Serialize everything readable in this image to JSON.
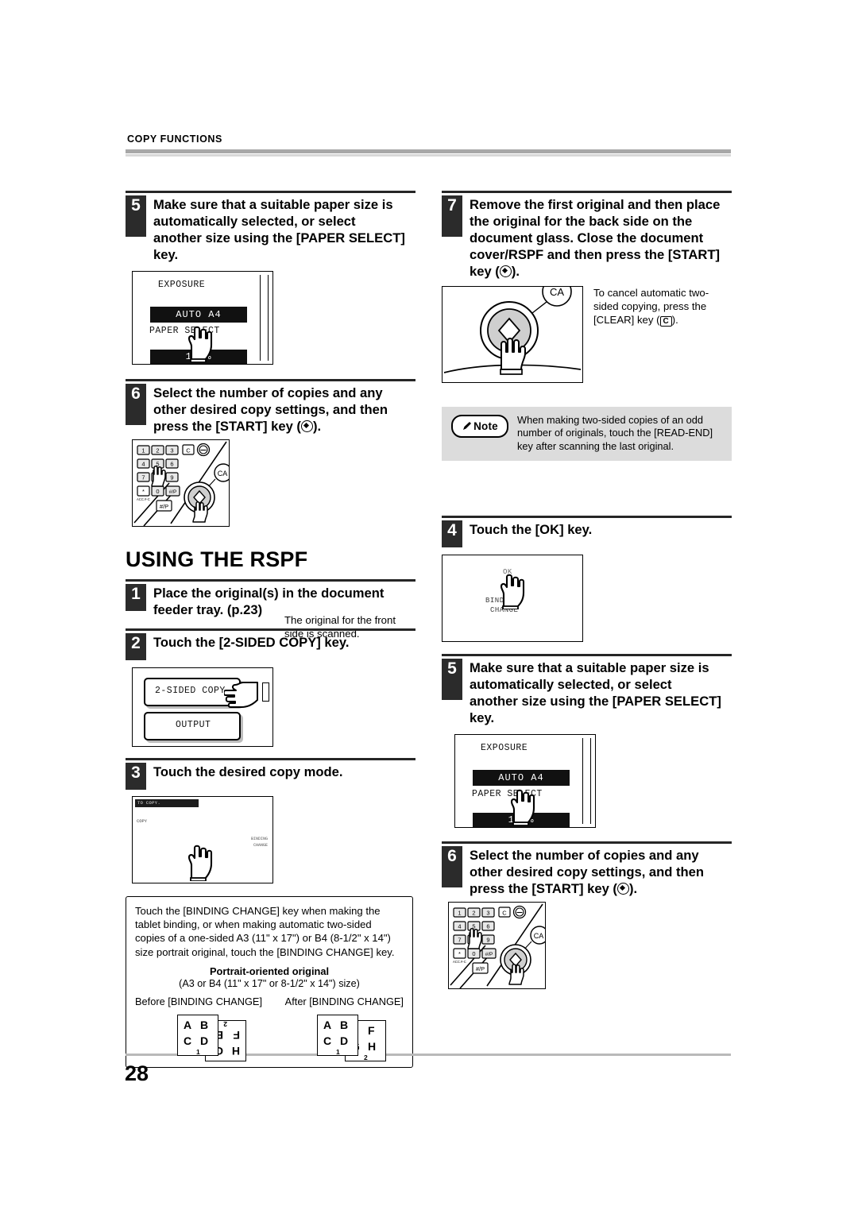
{
  "header": {
    "running_head": "COPY FUNCTIONS"
  },
  "page_number": "28",
  "left_column": {
    "step5": {
      "number": "5",
      "text": "Make sure that a suitable paper size is automatically selected, or select another size using the [PAPER SELECT] key.",
      "figure": {
        "name": "exposure-paper-select-lcd",
        "exposure_label": "EXPOSURE",
        "auto_bar": "AUTO    A4",
        "paper_select_label": "PAPER SELECT",
        "zoom_bar": "100%"
      }
    },
    "step6": {
      "number": "6",
      "text_before_icon": "Select the number of copies and any other desired copy settings, and then press the [START] key (",
      "text_after_icon": ").",
      "side_text": "The original for the front side is scanned.",
      "figure": {
        "name": "numeric-keypad-start-key",
        "keys": [
          "1",
          "2",
          "3",
          "C",
          "4",
          "5",
          "6",
          "7",
          "8",
          "9",
          "*",
          "0",
          "#/P"
        ],
        "acc_label": "ACC.#-C",
        "hash_p_label": "#/P",
        "ca_label": "CA"
      }
    }
  },
  "right_column": {
    "step7": {
      "number": "7",
      "text_before_icon": "Remove the first original and then place the original for the back side on the document glass. Close the document cover/RSPF and then press the [START] key (",
      "text_after_icon": ").",
      "figure": {
        "name": "start-key-document-glass",
        "ca_label": "CA"
      },
      "side_text_1": "To cancel automatic two-sided copying, press the [CLEAR] key (",
      "side_text_2": ").",
      "clear_key_glyph": "C"
    },
    "note": {
      "badge": "Note",
      "text": "When making two-sided copies of an odd number of originals, touch the [READ-END] key after scanning the last original."
    }
  },
  "section": {
    "heading": "USING THE RSPF",
    "step1": {
      "number": "1",
      "text": "Place the original(s) in the document feeder tray. (p.23)"
    },
    "step2": {
      "number": "2",
      "text": "Touch the [2-SIDED COPY] key.",
      "figure": {
        "name": "two-sided-copy-output-lcd",
        "button_1": "2-SIDED COPY",
        "button_2": "OUTPUT"
      }
    },
    "step3": {
      "number": "3",
      "text": "Touch the desired copy mode.",
      "figure": {
        "name": "copy-mode-lcd",
        "title_bar": "TO COPY.",
        "copy_label": "COPY",
        "right_label_1": "BINDING",
        "right_label_2": "CHANGE"
      }
    },
    "step4": {
      "number": "4",
      "text": "Touch the [OK] key.",
      "figure": {
        "name": "ok-binding-change-lcd",
        "ok_label": "OK",
        "binding_label": "BINDING",
        "change_label": "CHANGE"
      }
    },
    "step5": {
      "number": "5",
      "text": "Make sure that a suitable paper size is automatically selected, or select another size using the [PAPER SELECT] key.",
      "figure": {
        "name": "exposure-paper-select-lcd",
        "exposure_label": "EXPOSURE",
        "auto_bar": "AUTO    A4",
        "paper_select_label": "PAPER SELECT",
        "zoom_bar": "100%"
      }
    },
    "step6": {
      "number": "6",
      "text_before_icon": "Select the number of copies and any other desired copy settings, and then press the [START] key (",
      "text_after_icon": ").",
      "figure": {
        "name": "numeric-keypad-start-key",
        "keys": [
          "1",
          "2",
          "3",
          "C",
          "4",
          "5",
          "6",
          "7",
          "8",
          "9",
          "*",
          "0",
          "#/P"
        ],
        "acc_label": "ACC.#-C",
        "hash_p_label": "#/P",
        "ca_label": "CA"
      }
    }
  },
  "explanation": {
    "paragraph": "Touch the [BINDING CHANGE] key when making the tablet binding, or when making automatic two-sided copies of a one-sided A3 (11\" x 17\") or B4 (8-1/2\" x 14\") size portrait original, touch the [BINDING CHANGE] key.",
    "title": "Portrait-oriented original",
    "subtitle": "(A3 or B4 (11\" x 17\" or 8-1/2\" x 14\") size)",
    "before_label": "Before [BINDING CHANGE]",
    "after_label": "After [BINDING CHANGE]",
    "sheet_letters": {
      "front_top_left": "A",
      "front_top_right": "B",
      "front_bottom_left": "C",
      "front_bottom_right": "D",
      "back_top_left": "E",
      "back_top_right": "F",
      "back_bottom_left": "G",
      "back_bottom_right": "H"
    },
    "page_marks": {
      "front": "1",
      "back": "2"
    }
  },
  "colors": {
    "ink": "#000000",
    "step_badge": "#2b2b2b",
    "note_bg": "#dcdcdc",
    "rule_gray": "#a8a8a8",
    "key_gray": "#d0d0d0"
  }
}
